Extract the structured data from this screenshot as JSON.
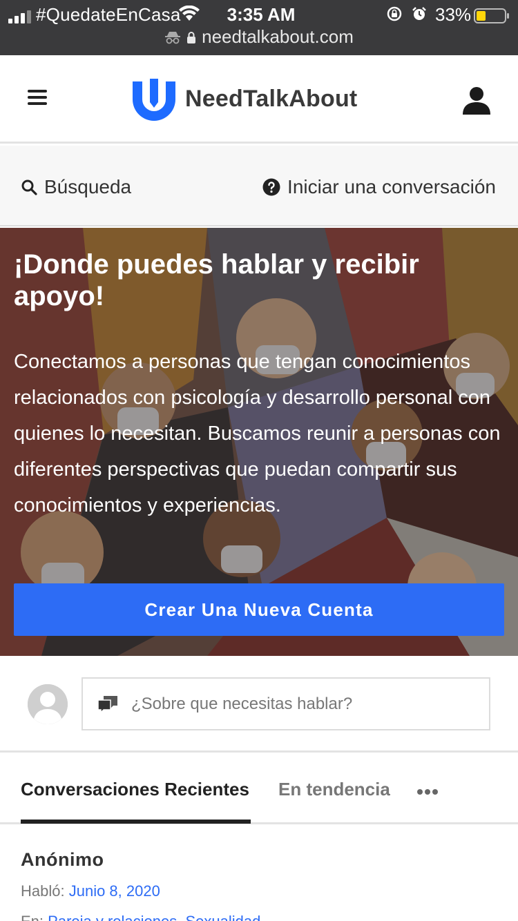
{
  "status_bar": {
    "carrier": "#QuedateEnCasa",
    "time": "3:35 AM",
    "battery_percent": "33%",
    "battery_level": 0.33,
    "url": "needtalkabout.com"
  },
  "header": {
    "brand": "NeedTalkAbout",
    "brand_color": "#1e6bff",
    "icons": [
      "hamburger-menu-icon",
      "logo-icon",
      "user-icon"
    ]
  },
  "subnav": {
    "search_label": "Búsqueda",
    "start_label": "Iniciar una conversación"
  },
  "hero": {
    "title": "¡Donde puedes hablar y recibir apoyo!",
    "description": "Conectamos a personas que tengan conocimientos relacionados con psicología y desarrollo personal con quienes lo necesitan. Buscamos reunir a personas con diferentes perspectivas que puedan compartir sus conocimientos y experiencias.",
    "button_label": "Crear Una Nueva Cuenta",
    "button_color": "#2d6cf5"
  },
  "composer": {
    "placeholder": "¿Sobre que necesitas hablar?"
  },
  "tabs": {
    "items": [
      {
        "label": "Conversaciones Recientes",
        "active": true
      },
      {
        "label": "En tendencia",
        "active": false
      }
    ]
  },
  "post": {
    "author": "Anónimo",
    "spoke_label": "Habló:",
    "date": "Junio 8, 2020",
    "in_label": "En:",
    "categories": "Pareja y relaciones, Sexualidad"
  }
}
